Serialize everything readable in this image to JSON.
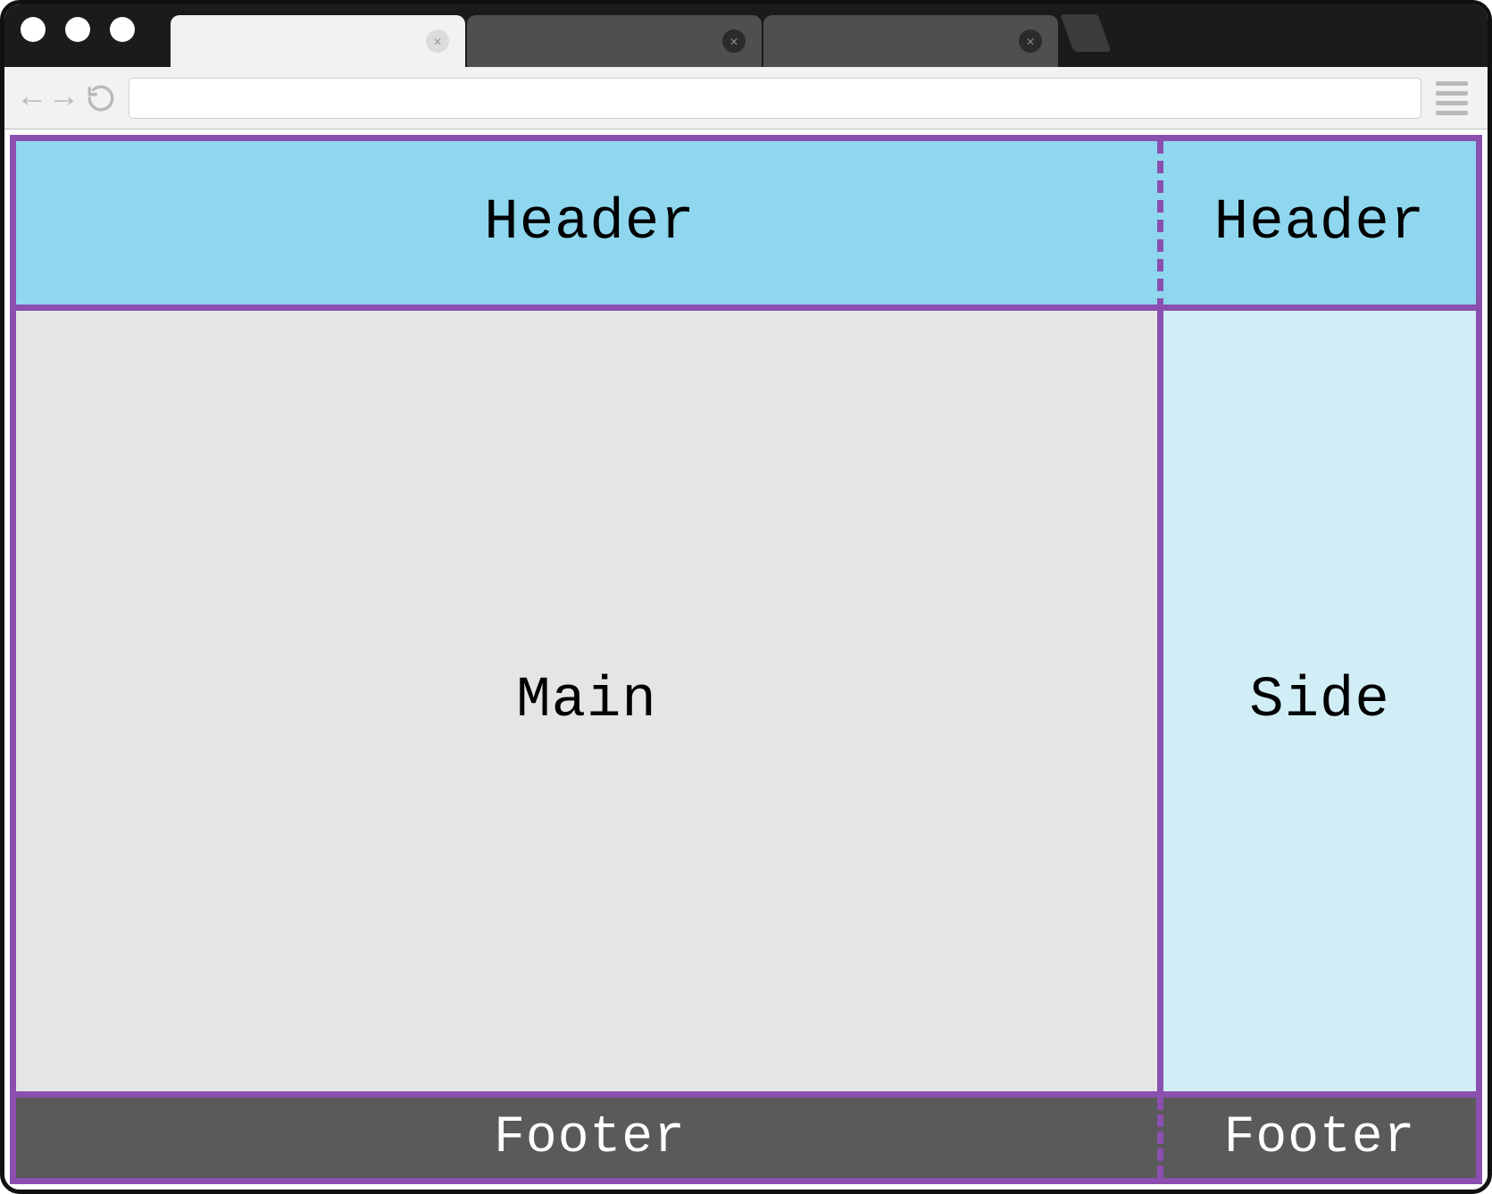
{
  "browser": {
    "traffic_lights": 3,
    "tabs": [
      {
        "active": true,
        "has_close": true
      },
      {
        "active": false,
        "has_close": true
      },
      {
        "active": false,
        "has_close": true
      }
    ],
    "url": "",
    "placeholders": {
      "url": ""
    }
  },
  "layout": {
    "grid_border_color": "#8b4fb0",
    "header": {
      "bg": "#8fd7ef",
      "label_left": "Header",
      "label_right": "Header",
      "divider": "dashed"
    },
    "main": {
      "bg": "#e5e5e5",
      "label": "Main"
    },
    "side": {
      "bg": "#d1eef6",
      "label": "Side"
    },
    "footer": {
      "bg": "#5a5a5a",
      "fg": "#ffffff",
      "label_left": "Footer",
      "label_right": "Footer",
      "divider": "dashed"
    }
  }
}
